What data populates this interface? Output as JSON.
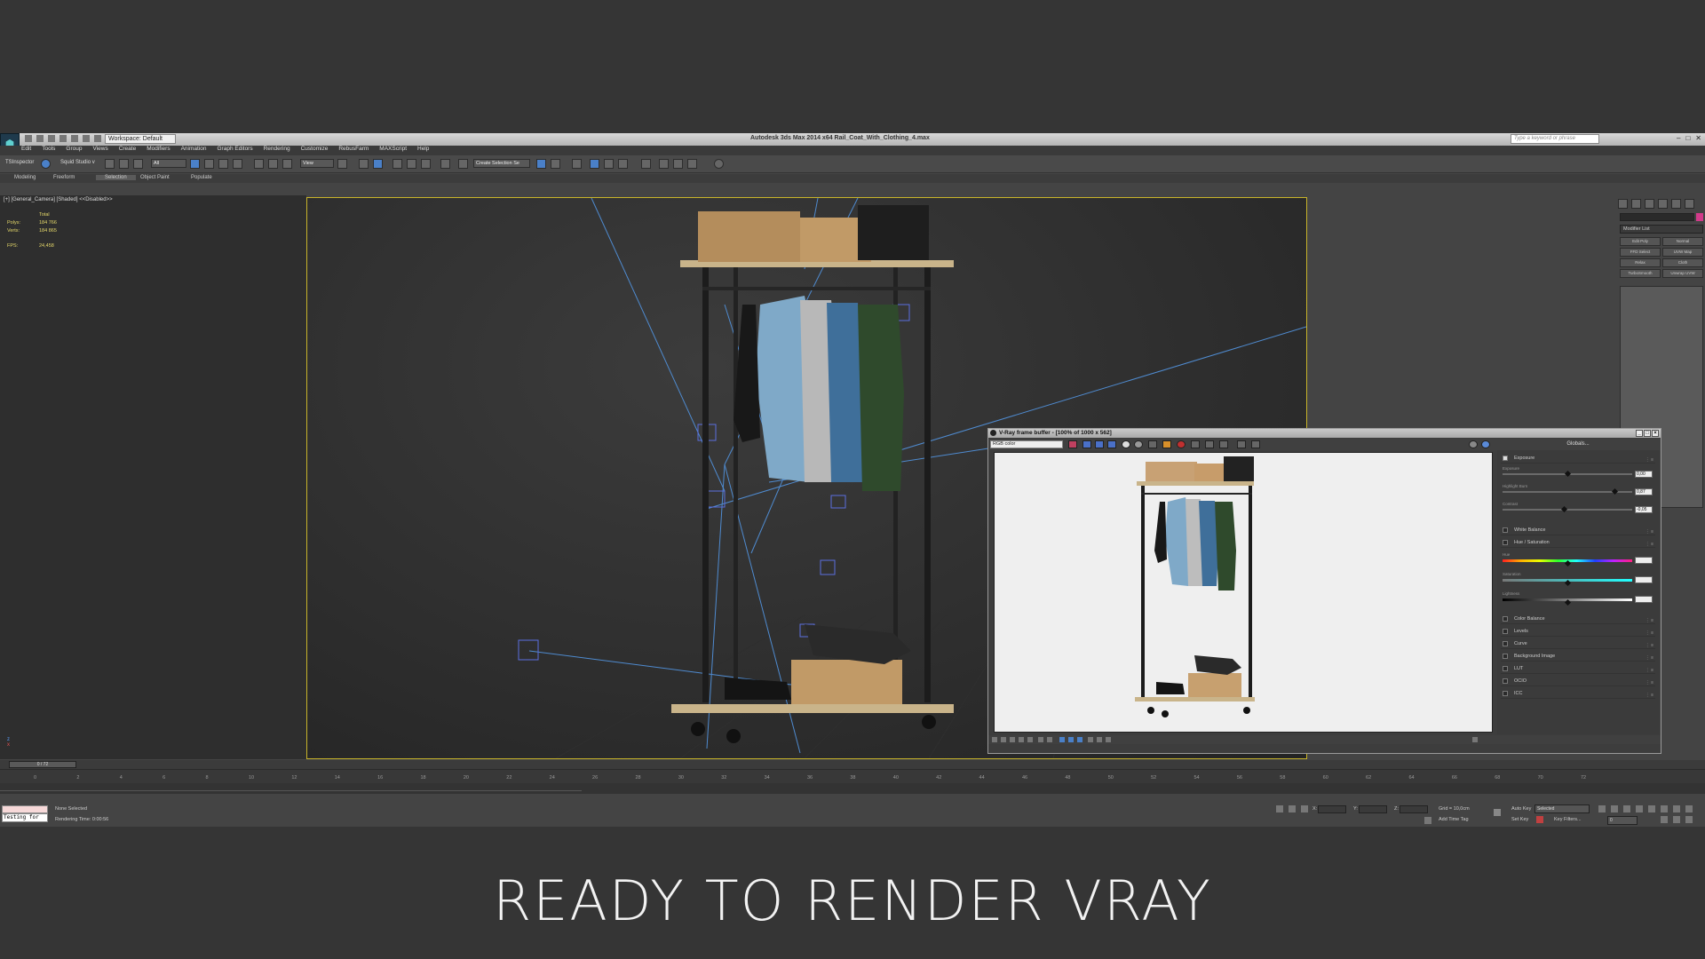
{
  "window": {
    "title": "Autodesk 3ds Max  2014 x64     Rail_Coat_With_Clothing_4.max",
    "workspace": "Workspace: Default",
    "search_placeholder": "Type a keyword or phrase",
    "app_icon": "3ds-max-logo-icon"
  },
  "menu": [
    "Edit",
    "Tools",
    "Group",
    "Views",
    "Create",
    "Modifiers",
    "Animation",
    "Graph Editors",
    "Rendering",
    "Customize",
    "RebusFarm",
    "MAXScript",
    "Help"
  ],
  "toolbar": {
    "left_label": "TSInspector",
    "studio_label": "Squid Studio v",
    "filter_value": "All",
    "view_value": "View",
    "selection_set_placeholder": "Create Selection Se"
  },
  "ribbon_tabs": [
    "Modeling",
    "Freeform",
    "Selection",
    "Object Paint",
    "Populate"
  ],
  "ribbon_active": "Selection",
  "viewport": {
    "label": "[+] [General_Camera] [Shaded] <<Disabled>>",
    "stats_header": "Total",
    "polys_label": "Polys:",
    "polys_value": "184 766",
    "verts_label": "Verts:",
    "verts_value": "184 865",
    "fps_label": "FPS:",
    "fps_value": "24,458",
    "axis_label_x": "x",
    "axis_label_z": "z"
  },
  "command_panel": {
    "modifier_list": "Modifier List",
    "modifiers": [
      "Edit Poly",
      "Normal",
      "FFD Select",
      "UVW Map",
      "Relax",
      "Cloth",
      "TurboSmooth",
      "Unwrap UVW"
    ]
  },
  "vfb": {
    "title": "V-Ray frame buffer - [100% of 1000 x 562]",
    "channel": "RGB color",
    "globals": "Globals...",
    "color_correction": {
      "exposure": {
        "label": "Exposure",
        "sliders": [
          {
            "label": "Exposure",
            "value": "0,00",
            "pos": 0.5
          },
          {
            "label": "Highlight Burn",
            "value": "0,87",
            "pos": 0.87
          },
          {
            "label": "Contrast",
            "value": "-0,05",
            "pos": 0.47
          }
        ]
      },
      "white_balance": "White Balance",
      "hue_saturation": {
        "label": "Hue / Saturation",
        "sliders": [
          {
            "label": "Hue",
            "value": "",
            "pos": 0.5
          },
          {
            "label": "Saturation",
            "value": "",
            "pos": 0.5
          },
          {
            "label": "Lightness",
            "value": "",
            "pos": 0.5
          }
        ]
      },
      "sections": [
        "Color Balance",
        "Levels",
        "Curve",
        "Background Image",
        "LUT",
        "OCIO",
        "ICC"
      ]
    }
  },
  "timeline": {
    "frame": "0 / 72",
    "ticks": [
      "0",
      "2",
      "4",
      "6",
      "8",
      "10",
      "12",
      "14",
      "16",
      "18",
      "20",
      "22",
      "24",
      "26",
      "28",
      "30",
      "32",
      "34",
      "36",
      "38",
      "40",
      "42",
      "44",
      "46",
      "48",
      "50",
      "52",
      "54",
      "56",
      "58",
      "60",
      "62",
      "64",
      "66",
      "68",
      "70",
      "72"
    ]
  },
  "status": {
    "maxscript_text": "Testing for",
    "selection": "None Selected",
    "render_time": "Rendering Time: 0:00:56",
    "x_label": "X:",
    "y_label": "Y:",
    "z_label": "Z:",
    "grid": "Grid = 10,0cm",
    "add_time_tag": "Add Time Tag",
    "auto_key": "Auto Key",
    "auto_key_value": "Selected",
    "set_key": "Set Key",
    "key_filters": "Key Filters...",
    "frame_value": "0"
  },
  "caption": "READY TO RENDER VRAY",
  "colors": {
    "viewport_border": "#c8b42a",
    "stats": "#e6d96a",
    "accent_blue": "#4a80c8"
  }
}
